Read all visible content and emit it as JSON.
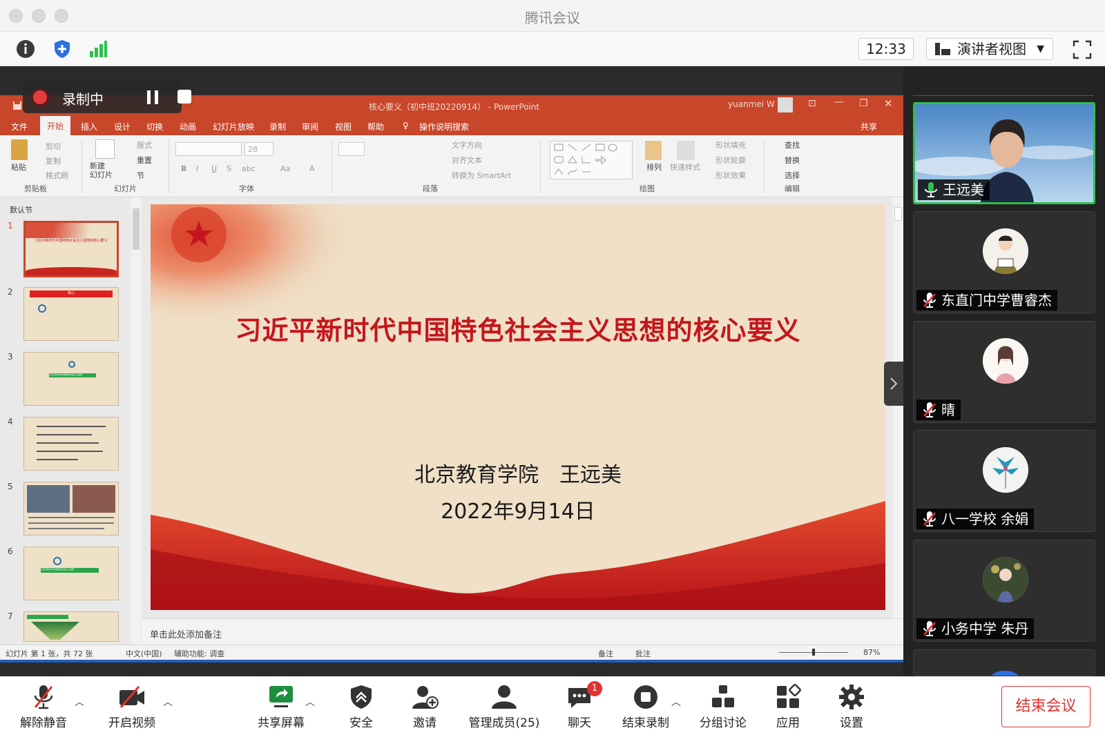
{
  "window": {
    "title": "腾讯会议"
  },
  "toolbar": {
    "clock": "12:33",
    "view_label": "演讲者视图"
  },
  "recording": {
    "label": "录制中"
  },
  "ppt": {
    "doc_title": "核心要义（初中班20220914） - PowerPoint",
    "user": "yuanmei W",
    "menu": [
      "文件",
      "开始",
      "插入",
      "设计",
      "切换",
      "动画",
      "幻灯片放映",
      "录制",
      "审阅",
      "视图",
      "帮助",
      "操作说明搜索"
    ],
    "share": "共享",
    "ribbon": {
      "paste": "粘贴",
      "cut": "剪切",
      "copy": "复制",
      "format_painter": "格式刷",
      "clipboard": "剪贴板",
      "new_slide": "新建\n幻灯片",
      "layout": "版式",
      "reset": "重置",
      "section": "节",
      "slides": "幻灯片",
      "font_size": "28",
      "font": "字体",
      "paragraph": "段落",
      "text_direction": "文字方向",
      "align_text": "对齐文本",
      "smartart": "转换为 SmartArt",
      "arrange": "排列",
      "quick_styles": "快速样式",
      "shape_fill": "形状填充",
      "shape_outline": "形状轮廓",
      "shape_effects": "形状效果",
      "drawing": "绘图",
      "find": "查找",
      "replace": "替换",
      "select": "选择",
      "editing": "编辑"
    },
    "section_label": "默认节",
    "thumb_numbers": [
      "1",
      "2",
      "3",
      "4",
      "5",
      "6",
      "7"
    ],
    "thumb_texts": {
      "t1_title": "习近平新时代中国特色社会主义思想的核心要义",
      "t2_head": "核心",
      "t3_label": "习近平新时代中国特色社会主义思想",
      "t6_label": "习近平新时代中国特色社会主义思想"
    },
    "slide": {
      "title": "习近平新时代中国特色社会主义思想的核心要义",
      "author": "北京教育学院　王远美",
      "date": "2022年9月14日"
    },
    "notes_placeholder": "单击此处添加备注",
    "status": {
      "slide_count": "幻灯片 第 1 张，共 72 张",
      "language": "中文(中国)",
      "accessibility": "辅助功能: 调查",
      "notes": "备注",
      "comments": "批注",
      "zoom": "87%"
    }
  },
  "participants": [
    {
      "name": "王远美",
      "mic": "on",
      "active": true
    },
    {
      "name": "东直门中学曹睿杰",
      "mic": "muted"
    },
    {
      "name": "晴",
      "mic": "muted"
    },
    {
      "name": "八一学校 余娟",
      "mic": "muted"
    },
    {
      "name": "小务中学 朱丹",
      "mic": "muted"
    }
  ],
  "bottombar": {
    "unmute": "解除静音",
    "start_video": "开启视频",
    "share_screen": "共享屏幕",
    "security": "安全",
    "invite": "邀请",
    "manage_members": "管理成员(25)",
    "chat": "聊天",
    "chat_badge": "1",
    "stop_recording": "结束录制",
    "breakout": "分组讨论",
    "apps": "应用",
    "settings": "设置",
    "end_meeting": "结束会议"
  },
  "colors": {
    "accent_red": "#e03131",
    "ppt_orange": "#c8462a",
    "active_green": "#2fbf4e",
    "slide_title_red": "#c4161c"
  }
}
